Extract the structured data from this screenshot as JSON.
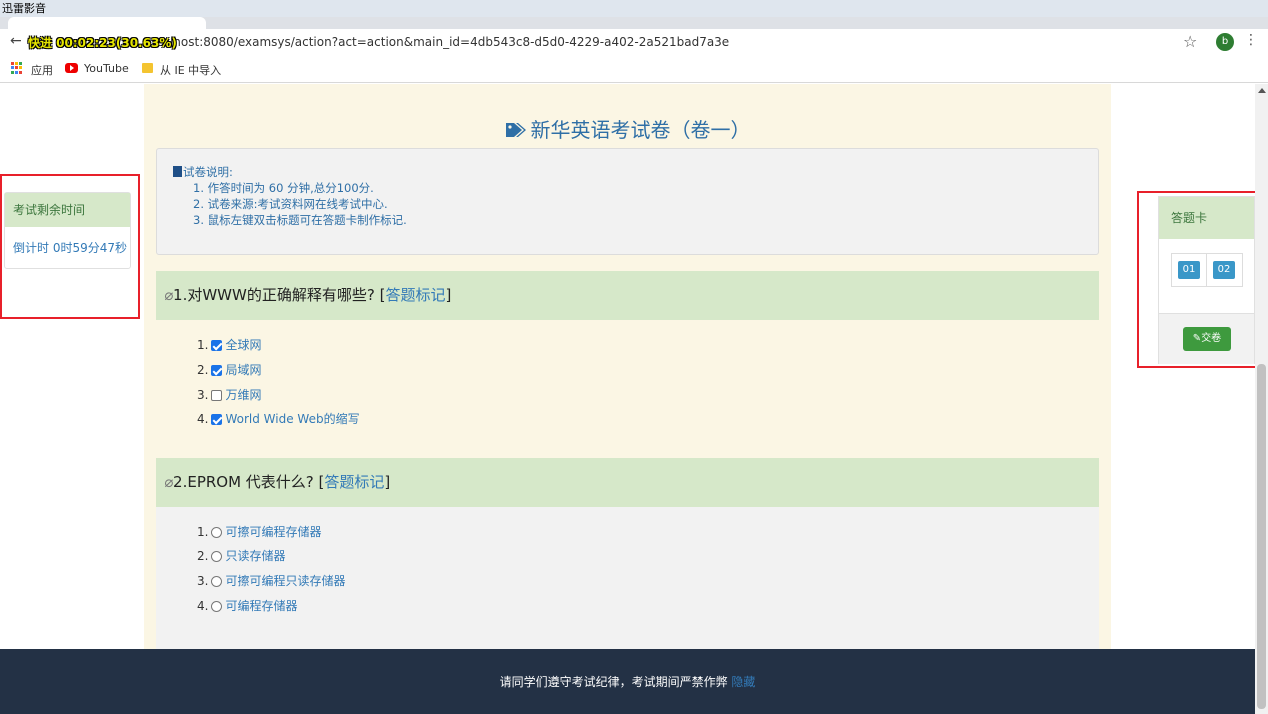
{
  "player": {
    "title": "迅雷影音",
    "overlay": "快进 00:02:23(30.63%)"
  },
  "browser": {
    "url": "calhost:8080/examsys/action?act=action&main_id=4db543c8-d5d0-4229-a402-2a521bad7a3e",
    "avatar_letter": "b",
    "bookmarks": {
      "apps": "应用",
      "youtube": "YouTube",
      "ie": "从 IE 中导入"
    }
  },
  "timer": {
    "heading": "考试剩余时间",
    "countdown": "倒计时 0时59分47秒"
  },
  "exam": {
    "title": "新华英语考试卷（卷一）",
    "notice_title": "试卷说明:",
    "notice_lines": [
      "1. 作答时间为 60 分钟,总分100分.",
      "2. 试卷来源:考试资料网在线考试中心.",
      "3. 鼠标左键双击标题可在答题卡制作标记."
    ]
  },
  "questions": [
    {
      "title": "1.对WWW的正确解释有哪些?",
      "mark_label": "答题标记",
      "type": "multiple",
      "options": [
        {
          "num": "1.",
          "text": "全球网",
          "checked": true
        },
        {
          "num": "2.",
          "text": "局域网",
          "checked": true
        },
        {
          "num": "3.",
          "text": "万维网",
          "checked": false
        },
        {
          "num": "4.",
          "text": "World Wide Web的缩写",
          "checked": true
        }
      ]
    },
    {
      "title": "2.EPROM 代表什么?",
      "mark_label": "答题标记",
      "type": "single",
      "options": [
        {
          "num": "1.",
          "text": "可擦可编程存储器",
          "checked": false
        },
        {
          "num": "2.",
          "text": "只读存储器",
          "checked": false
        },
        {
          "num": "3.",
          "text": "可擦可编程只读存储器",
          "checked": false
        },
        {
          "num": "4.",
          "text": "可编程存储器",
          "checked": false
        }
      ]
    }
  ],
  "answer_card": {
    "heading": "答题卡",
    "items": [
      "01",
      "02"
    ],
    "submit_label": "交卷"
  },
  "footer": {
    "text": "请同学们遵守考试纪律，考试期间严禁作弊",
    "hide_label": "隐藏"
  },
  "colors": {
    "panel_green": "#d6e8c9",
    "link_blue": "#337ab7",
    "footer_bg": "#233145",
    "highlight_red": "#e8202a"
  }
}
